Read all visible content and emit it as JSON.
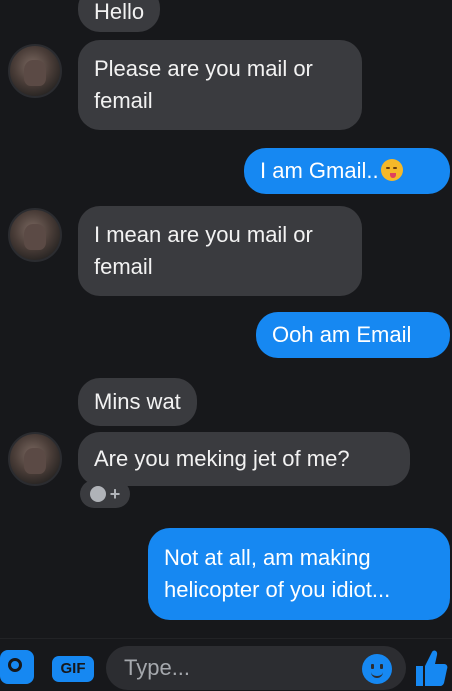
{
  "messages": [
    {
      "from": "them",
      "text": "Hello"
    },
    {
      "from": "them",
      "text": "Please are you mail or femail"
    },
    {
      "from": "me",
      "text": "I am Gmail.."
    },
    {
      "from": "them",
      "text": "I mean are you mail or femail"
    },
    {
      "from": "me",
      "text": "Ooh am Email"
    },
    {
      "from": "them",
      "text": "Mins wat"
    },
    {
      "from": "them",
      "text": "Are you meking jet of me?"
    },
    {
      "from": "me",
      "text": "Not at all, am making helicopter of you idiot..."
    }
  ],
  "composer": {
    "placeholder": "Type...",
    "gif_label": "GIF"
  },
  "icons": {
    "camera": "camera-icon",
    "gif": "gif-icon",
    "emoji": "emoji-icon",
    "like": "thumbs-up-icon",
    "reaction": "add-reaction-icon"
  },
  "colors": {
    "background": "#17181b",
    "incoming_bubble": "#3a3b3f",
    "outgoing_bubble": "#1688f2"
  }
}
